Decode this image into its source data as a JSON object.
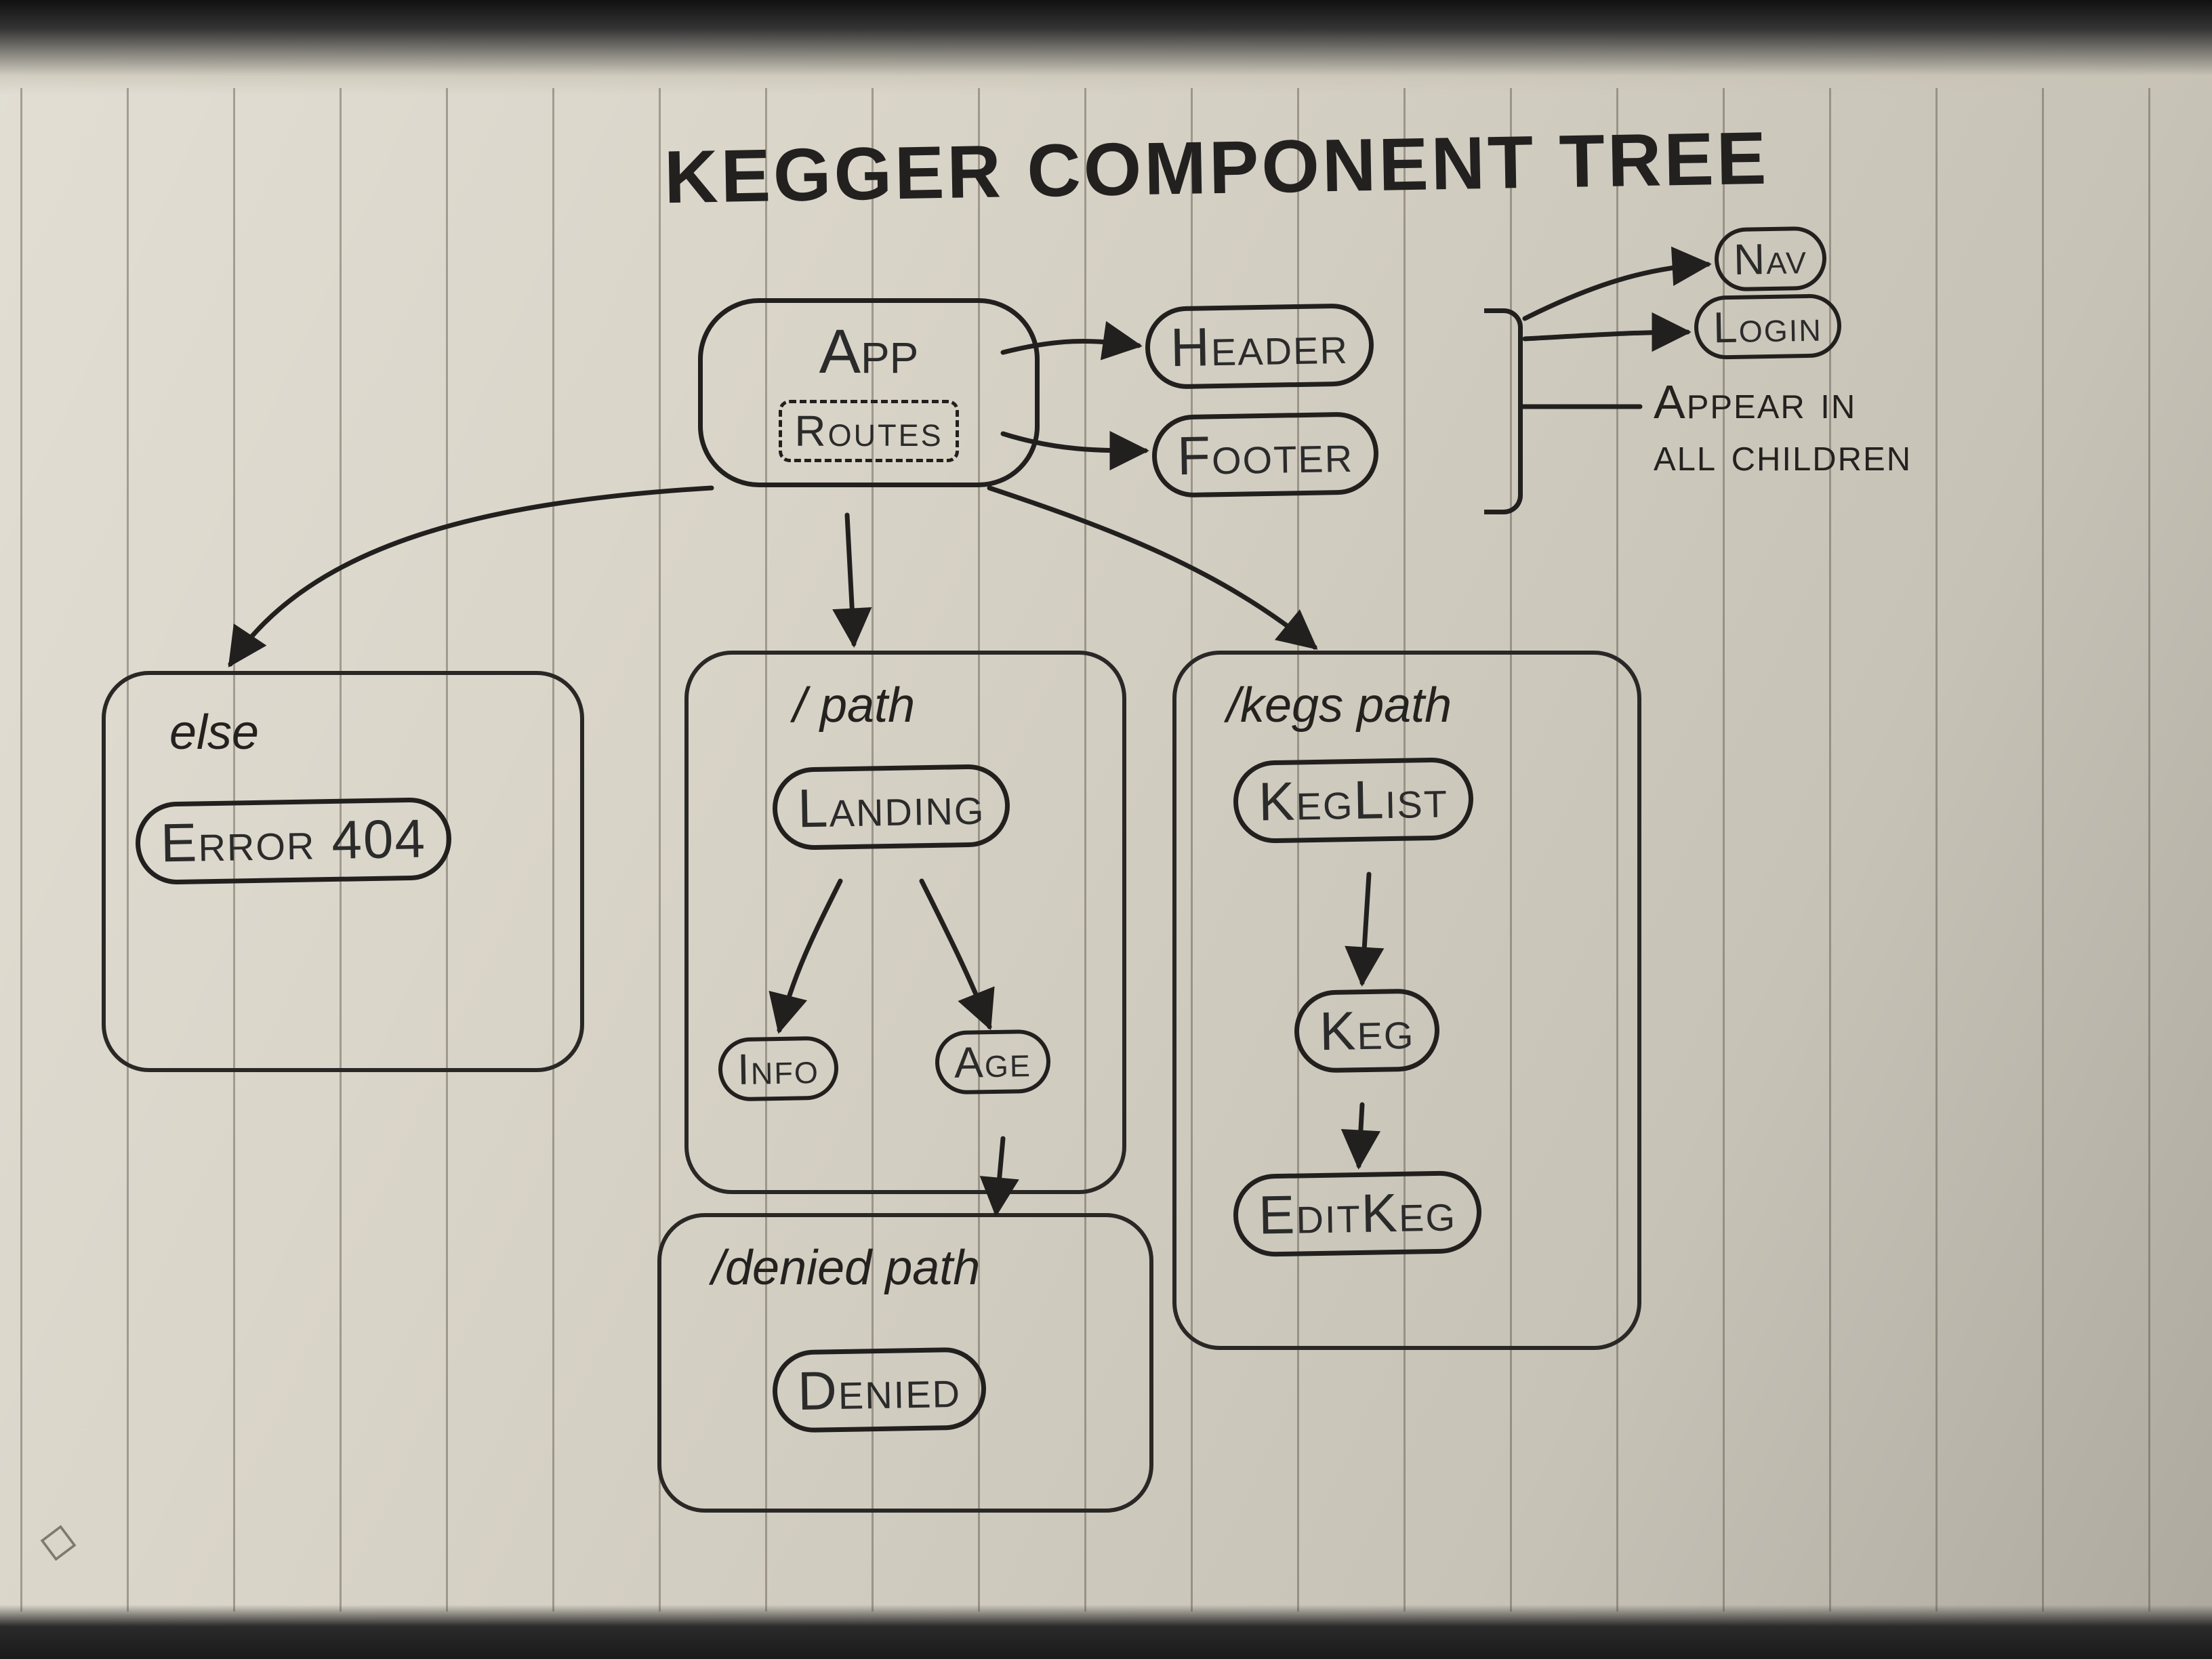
{
  "title": "KEGGER COMPONENT TREE",
  "app": {
    "label": "App",
    "routes": "Routes"
  },
  "persistent": {
    "header": "Header",
    "footer": "Footer",
    "nav": "Nav",
    "login": "Login",
    "annotation": "Appear in\nall children"
  },
  "routes": {
    "else": {
      "label": "else",
      "node": "Error 404"
    },
    "root": {
      "label": "/ path",
      "landing": "Landing",
      "info": "Info",
      "age": "Age"
    },
    "denied": {
      "label": "/denied path",
      "node": "Denied"
    },
    "kegs": {
      "label": "/kegs path",
      "list": "KegList",
      "keg": "Keg",
      "edit": "EditKeg"
    }
  },
  "logo_glyph": "◇"
}
